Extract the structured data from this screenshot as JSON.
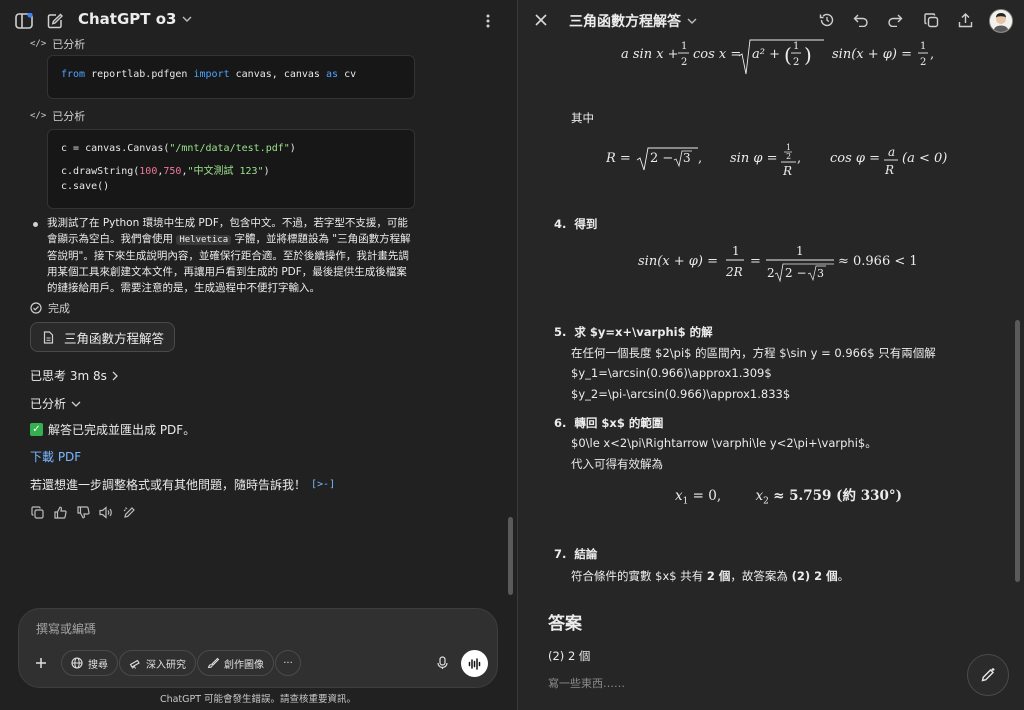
{
  "chat": {
    "model_name": "ChatGPT o3",
    "code_block_1": {
      "kw_from": "from",
      "module": "reportlab.pdfgen",
      "kw_import": "import",
      "name1": "canvas,",
      "name2": "canvas",
      "kw_as": "as",
      "alias": "cv"
    },
    "analysis_label": "已分析",
    "truncated_label": "已分析",
    "code_block_2": {
      "line1_pre": "c = canvas.Canvas(",
      "line1_str": "\"/mnt/data/test.pdf\"",
      "line1_post": ")",
      "line2_pre": "c.drawString(",
      "line2_n1": "100",
      "line2_sep1": ",",
      "line2_n2": "750",
      "line2_sep2": ",",
      "line2_str": "\"中文測試 123\"",
      "line2_post": ")",
      "line3": "c.save()"
    },
    "bullet_part1": "我測試了在 Python 環境中生成 PDF，包含中文。不過，若字型不支援，可能會顯示為空白。我們會使用 ",
    "bullet_code": "Helvetica",
    "bullet_part2": " 字體，並將標題設為 \"三角函數方程解答說明\"。接下來生成說明內容，並確保行距合適。至於後續操作，我計畫先調用某個工具來創建文本文件，再讓用戶看到生成的 PDF，最後提供生成後檔案的鏈接給用戶。需要注意的是，生成過程中不便打字輸入。",
    "done_label": "完成",
    "doc_chip_label": "三角函數方程解答",
    "thought_label": "已思考 3m 8s",
    "analyzed_label": "已分析",
    "completed_text": "解答已完成並匯出成 PDF。",
    "download_link": "下載 PDF",
    "followup_text": "若還想進一步調整格式或有其他問題，隨時告訴我！"
  },
  "composer": {
    "placeholder": "撰寫或編碼",
    "search_label": "搜尋",
    "research_label": "深入研究",
    "image_label": "創作圖像",
    "more_label": "···"
  },
  "disclaimer": "ChatGPT 可能會發生錯誤。請查核重要資訊。",
  "canvas": {
    "title": "三角函數方程解答",
    "where_label": "其中",
    "step4_num": "4.",
    "step4_title": "得到",
    "step5_num": "5.",
    "step5_title": "求 $y=x+\\varphi$ 的解",
    "step5_line1": "在任何一個長度 $2\\pi$ 的區間內，方程 $\\sin y = 0.966$ 只有兩個解",
    "step5_line2": "$y_1=\\arcsin(0.966)\\approx1.309$",
    "step5_line3": "$y_2=\\pi-\\arcsin(0.966)\\approx1.833$",
    "step6_num": "6.",
    "step6_title": "轉回 $x$ 的範圍",
    "step6_line1": "$0\\le x<2\\pi\\Rightarrow \\varphi\\le y<2\\pi+\\varphi$。",
    "step6_line2": "代入可得有效解為",
    "solution_x1": "= 0,",
    "solution_x2": "≈ 5.759 (約 330°)",
    "step7_num": "7.",
    "step7_title": "結論",
    "step7_pre": "符合條件的實數 $x$ 共有 ",
    "step7_bold1": "2 個",
    "step7_mid": "，故答案為 ",
    "step7_bold2": "(2) 2 個",
    "step7_post": "。",
    "answer_heading": "答案",
    "answer_value": "(2) 2 個",
    "write_hint": "寫一些東西……",
    "eq_top_val": "0.966 < 1"
  },
  "colors": {
    "link": "#7ab7ff",
    "keyword": "#4ea3ff",
    "string": "#9be28c",
    "number": "#f0789a",
    "check": "#35b04f"
  }
}
